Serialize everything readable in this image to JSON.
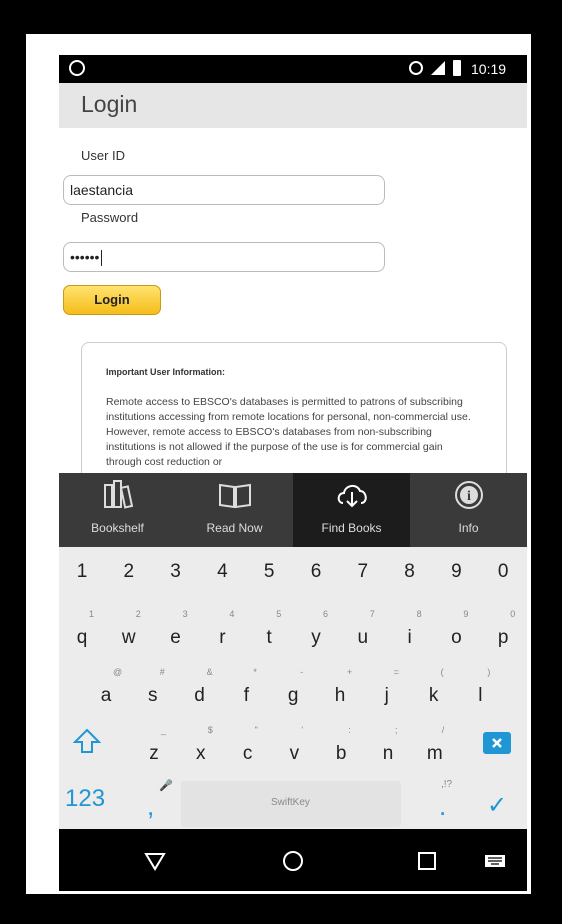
{
  "status_bar": {
    "time": "10:19"
  },
  "app": {
    "title": "Login",
    "form": {
      "user_id_label": "User ID",
      "user_id_value": "laestancia",
      "password_label": "Password",
      "password_value": "••••••",
      "login_button": "Login"
    },
    "info": {
      "heading": "Important User Information:",
      "body": "Remote access to EBSCO's databases is permitted to patrons of subscribing institutions accessing from remote locations for personal, non-commercial use. However, remote access to EBSCO's databases from non-subscribing institutions is not allowed if the purpose of the use is for commercial gain through cost reduction or"
    }
  },
  "tabbar": {
    "tabs": [
      {
        "label": "Bookshelf",
        "icon": "bookshelf-icon"
      },
      {
        "label": "Read Now",
        "icon": "open-book-icon"
      },
      {
        "label": "Find Books",
        "icon": "cloud-download-icon",
        "active": true
      },
      {
        "label": "Info",
        "icon": "info-icon"
      }
    ]
  },
  "keyboard": {
    "number_row": [
      "1",
      "2",
      "3",
      "4",
      "5",
      "6",
      "7",
      "8",
      "9",
      "0"
    ],
    "row1": [
      {
        "k": "q",
        "h": "1"
      },
      {
        "k": "w",
        "h": "2"
      },
      {
        "k": "e",
        "h": "3"
      },
      {
        "k": "r",
        "h": "4"
      },
      {
        "k": "t",
        "h": "5"
      },
      {
        "k": "y",
        "h": "6"
      },
      {
        "k": "u",
        "h": "7"
      },
      {
        "k": "i",
        "h": "8"
      },
      {
        "k": "o",
        "h": "9"
      },
      {
        "k": "p",
        "h": "0"
      }
    ],
    "row2": [
      {
        "k": "a",
        "h": "@"
      },
      {
        "k": "s",
        "h": "#"
      },
      {
        "k": "d",
        "h": "&"
      },
      {
        "k": "f",
        "h": "*"
      },
      {
        "k": "g",
        "h": "-"
      },
      {
        "k": "h",
        "h": "+"
      },
      {
        "k": "j",
        "h": "="
      },
      {
        "k": "k",
        "h": "("
      },
      {
        "k": "l",
        "h": ")"
      }
    ],
    "row3": [
      {
        "k": "z",
        "h": "_"
      },
      {
        "k": "x",
        "h": "$"
      },
      {
        "k": "c",
        "h": "\""
      },
      {
        "k": "v",
        "h": "'"
      },
      {
        "k": "b",
        "h": ":"
      },
      {
        "k": "n",
        "h": ";"
      },
      {
        "k": "m",
        "h": "/"
      }
    ],
    "symbols_key": "123",
    "comma_key": ",",
    "period_key": ".",
    "period_hint": ",!?",
    "space_brand": "SwiftKey",
    "accent_color": "#2196d4"
  }
}
